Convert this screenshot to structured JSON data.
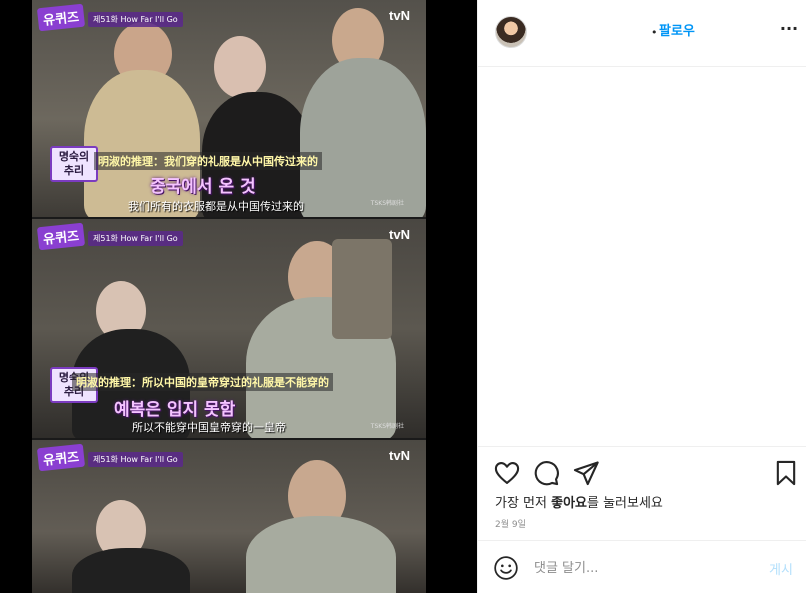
{
  "post": {
    "media": {
      "panels": [
        {
          "logo": "유퀴즈",
          "episode": "제51화 How Far I'll Go",
          "channel": "tvN",
          "mystery_label": "명숙의 추리",
          "cn_title": "明淑的推理：我们穿的礼服是从中国传过来的",
          "kr_caption": "중국에서 온 것",
          "cn_sub": "我们所有的衣服都是从中国传过来的",
          "watermark": "TSKS韩剧社"
        },
        {
          "logo": "유퀴즈",
          "episode": "제51화 How Far I'll Go",
          "channel": "tvN",
          "mystery_label": "명숙의 추리",
          "cn_title": "明淑的推理：所以中国的皇帝穿过的礼服是不能穿的",
          "kr_caption": "예복은 입지 못함",
          "cn_sub": "所以不能穿中国皇帝穿的一皇帝",
          "watermark": "TSKS韩剧社"
        },
        {
          "logo": "유퀴즈",
          "episode": "제51화 How Far I'll Go",
          "channel": "tvN"
        }
      ]
    },
    "header": {
      "follow_label": "팔로우",
      "dot": "•",
      "more_label": "···"
    },
    "actions": {
      "likes_prefix": "가장 먼저 ",
      "likes_bold": "좋아요",
      "likes_suffix": "를 눌러보세요",
      "date": "2월 9일"
    },
    "comment": {
      "placeholder": "댓글 달기...",
      "post_label": "게시"
    }
  },
  "colors": {
    "follow_blue": "#0095f6",
    "post_disabled": "#b2dffc",
    "border": "#efefef",
    "text": "#262626",
    "muted": "#8e8e8e"
  },
  "icons": [
    "heart-icon",
    "comment-icon",
    "share-icon",
    "bookmark-icon",
    "emoji-icon",
    "more-icon"
  ]
}
